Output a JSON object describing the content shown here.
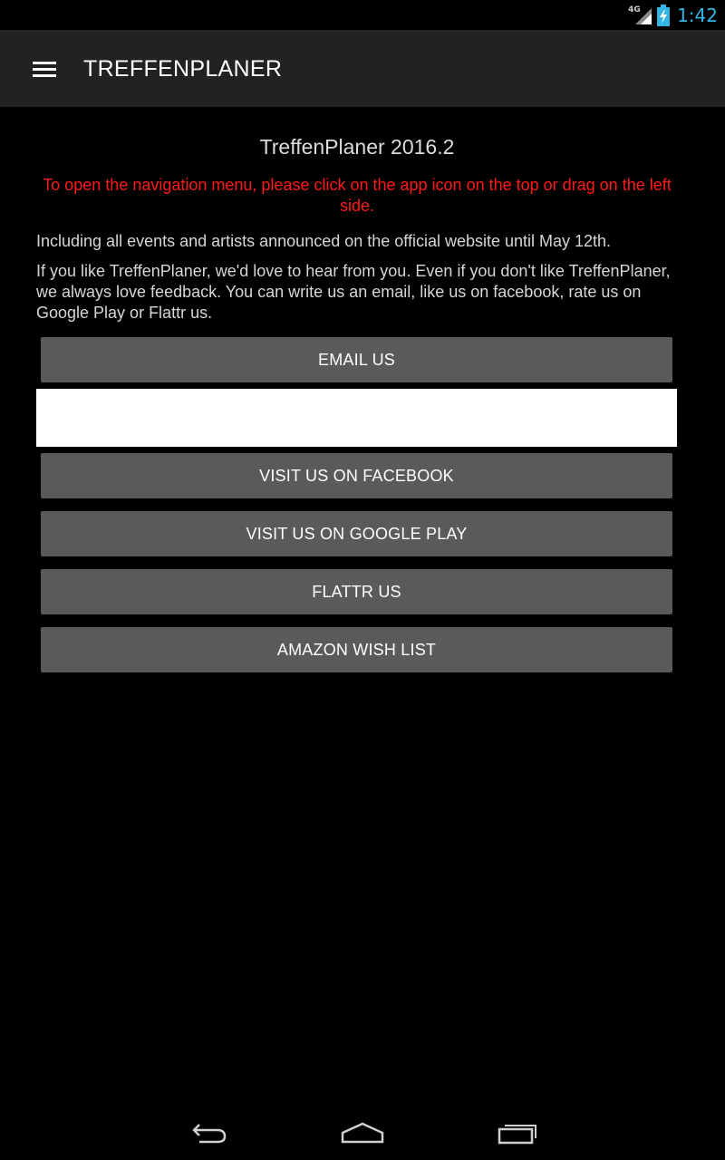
{
  "status_bar": {
    "network": "4G",
    "time": "1:42"
  },
  "action_bar": {
    "title": "TREFFENPLANER",
    "menu_icon": "hamburger-menu-icon"
  },
  "content": {
    "version_title": "TreffenPlaner 2016.2",
    "nav_hint": "To open the navigation menu, please click on the app icon on the top or drag on the left side.",
    "info_events": "Including all events and artists announced on the official website until May 12th.",
    "info_feedback": "If you like TreffenPlaner, we'd love to hear from you. Even if you don't like TreffenPlaner, we always love feedback. You can write us an email, like us on facebook, rate us on Google Play or Flattr us."
  },
  "buttons": {
    "email": "EMAIL US",
    "facebook": "VISIT US ON FACEBOOK",
    "google_play": "VISIT US ON GOOGLE PLAY",
    "flattr": "FLATTR US",
    "amazon": "AMAZON WISH LIST"
  },
  "colors": {
    "accent_blue": "#33b5e5",
    "hint_red": "#ff1a1a",
    "button_bg": "#5a5a5a",
    "action_bar_bg": "#222222"
  },
  "nav_bar": {
    "back_icon": "back-icon",
    "home_icon": "home-icon",
    "recents_icon": "recent-apps-icon"
  }
}
